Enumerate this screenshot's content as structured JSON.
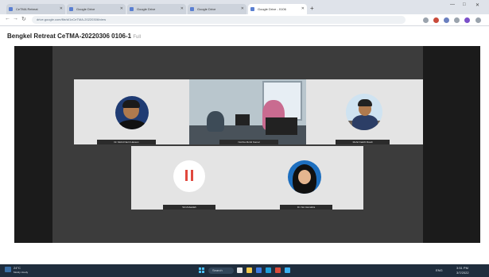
{
  "browser": {
    "tabs": [
      {
        "label": "CeTMA Retreat"
      },
      {
        "label": "Google Drive"
      },
      {
        "label": "Google Drive"
      },
      {
        "label": "Google Drive"
      },
      {
        "label": "Google Drive - 0106"
      }
    ],
    "new_tab": "+",
    "url": "drive.google.com/file/d/1xCeTMA-20220306/view",
    "window_controls": {
      "minimize": "—",
      "maximize": "□",
      "close": "✕"
    },
    "nav": {
      "back": "←",
      "forward": "→",
      "reload": "↻"
    },
    "toolbar_icon_colors": [
      "#9aa3ad",
      "#c94a3a",
      "#6a7fbf",
      "#9aa3ad",
      "#7a4fc9",
      "#9aa3ad"
    ]
  },
  "page": {
    "title": "Bengkel Retreat CeTMA-20220306 0106-1",
    "title_suffix": "Full"
  },
  "meeting": {
    "participants": [
      {
        "name": "Dr. Mohd Nazri Hassan",
        "avatar": "man-portrait"
      },
      {
        "name": "Norliza Mohd Kamal",
        "avatar": "group-room-video"
      },
      {
        "name": "Mohd Fadzli Rosdi",
        "avatar": "man-at-desk"
      },
      {
        "name": "Siti Zubaidah",
        "avatar": "muted-mic-icon"
      },
      {
        "name": "Dr. Nor Asmaliza",
        "avatar": "woman-hijab-portrait"
      }
    ],
    "muted_color": "#e0483e"
  },
  "taskbar": {
    "weather_temp": "24°C",
    "weather_text": "Mostly cloudy",
    "search_label": "Search",
    "app_colors": [
      "#e8e8e8",
      "#f2c94c",
      "#3d7be0",
      "#1f9ed8",
      "#d94b3a",
      "#3bb0f0"
    ],
    "clock_time": "3:51 PM",
    "clock_date": "3/7/2022",
    "lang": "ENG"
  }
}
